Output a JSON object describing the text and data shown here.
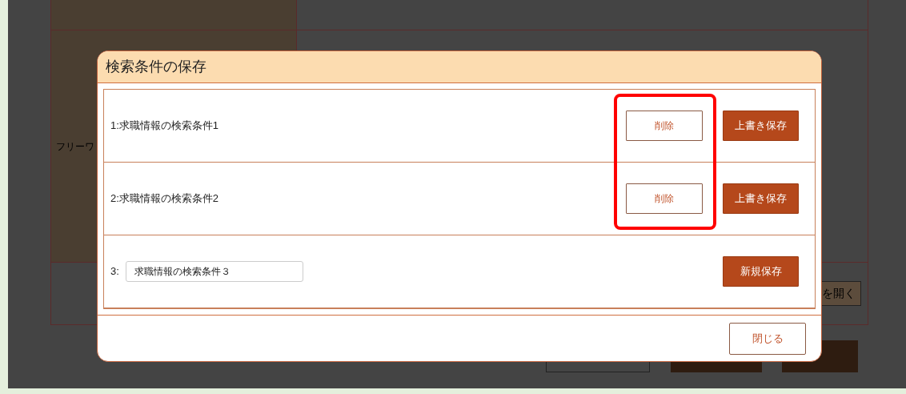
{
  "background": {
    "row_label": "フリーワ",
    "side_button": "を開く"
  },
  "dialog": {
    "title": "検索条件の保存",
    "entries": [
      {
        "kind": "saved",
        "label": "1:求職情報の検索条件1",
        "delete": "削除",
        "save": "上書き保存"
      },
      {
        "kind": "saved",
        "label": "2:求職情報の検索条件2",
        "delete": "削除",
        "save": "上書き保存"
      },
      {
        "kind": "new",
        "number": "3:",
        "value": "求職情報の検索条件３",
        "save": "新規保存"
      }
    ],
    "close": "閉じる"
  },
  "highlight_delete_buttons": true
}
